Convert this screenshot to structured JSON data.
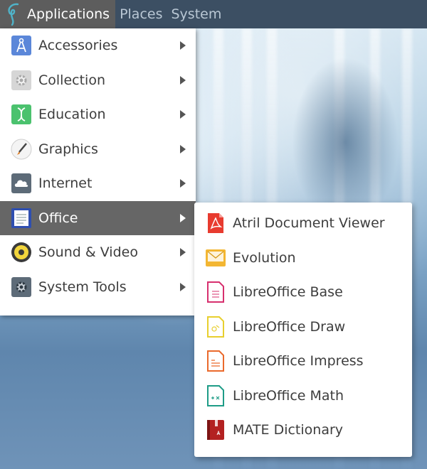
{
  "panel": {
    "applications_label": "Applications",
    "places_label": "Places",
    "system_label": "System"
  },
  "menu": {
    "items": [
      {
        "label": "Accessories",
        "icon": "compass-icon"
      },
      {
        "label": "Collection",
        "icon": "gear-icon"
      },
      {
        "label": "Education",
        "icon": "dna-icon"
      },
      {
        "label": "Graphics",
        "icon": "paintbrush-icon"
      },
      {
        "label": "Internet",
        "icon": "cloud-icon"
      },
      {
        "label": "Office",
        "icon": "document-icon",
        "selected": true
      },
      {
        "label": "Sound & Video",
        "icon": "speaker-icon"
      },
      {
        "label": "System Tools",
        "icon": "gear-icon"
      }
    ]
  },
  "submenu": {
    "items": [
      {
        "label": "Atril Document Viewer",
        "icon": "pdf-icon"
      },
      {
        "label": "Evolution",
        "icon": "envelope-icon"
      },
      {
        "label": "LibreOffice Base",
        "icon": "libreoffice-base-icon"
      },
      {
        "label": "LibreOffice Draw",
        "icon": "libreoffice-draw-icon"
      },
      {
        "label": "LibreOffice Impress",
        "icon": "libreoffice-impress-icon"
      },
      {
        "label": "LibreOffice Math",
        "icon": "libreoffice-math-icon"
      },
      {
        "label": "MATE Dictionary",
        "icon": "dictionary-icon"
      }
    ]
  }
}
